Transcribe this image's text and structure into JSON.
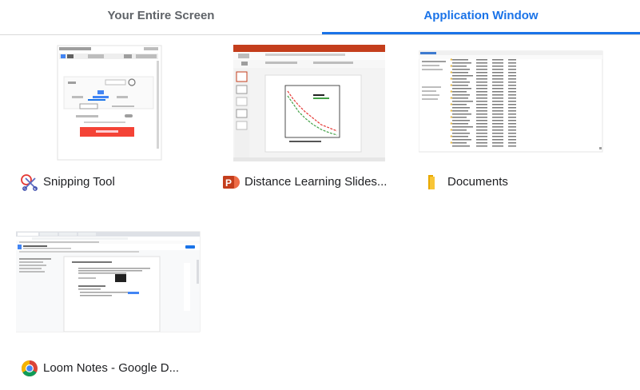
{
  "tabs": [
    {
      "label": "Your Entire Screen",
      "active": false
    },
    {
      "label": "Application Window",
      "active": true
    }
  ],
  "accent_color": "#1a73e8",
  "windows": [
    {
      "title": "Snipping Tool",
      "icon": "snipping-tool-icon"
    },
    {
      "title": "Distance Learning Slides...",
      "icon": "powerpoint-icon"
    },
    {
      "title": "Documents",
      "icon": "folder-icon"
    },
    {
      "title": "Loom Notes - Google D...",
      "icon": "chrome-icon"
    }
  ]
}
